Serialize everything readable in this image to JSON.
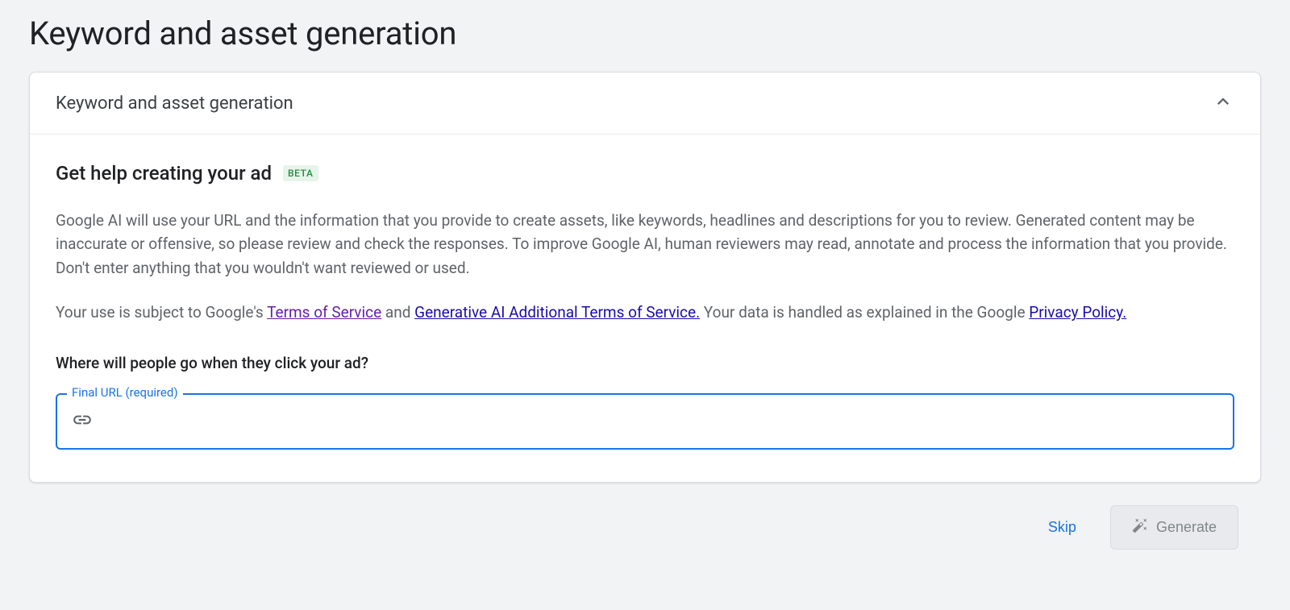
{
  "page": {
    "title": "Keyword and asset generation"
  },
  "card": {
    "header_title": "Keyword and asset generation",
    "section_heading": "Get help creating your ad",
    "badge": "BETA",
    "description": "Google AI will use your URL and the information that you provide to create assets, like keywords, headlines and descriptions for you to review. Generated content may be inaccurate or offensive, so please review and check the responses. To improve Google AI, human reviewers may read, annotate and process the information that you provide. Don't enter anything that you wouldn't want reviewed or used.",
    "legal": {
      "prefix": "Your use is subject to Google's ",
      "tos": "Terms of Service",
      "and": " and ",
      "gen_ai_tos": "Generative AI Additional Terms of Service.",
      "middle": " Your data is handled as explained in the Google ",
      "privacy": "Privacy Policy."
    },
    "question": "Where will people go when they click your ad?",
    "input": {
      "label": "Final URL (required)",
      "value": ""
    }
  },
  "actions": {
    "skip": "Skip",
    "generate": "Generate"
  }
}
